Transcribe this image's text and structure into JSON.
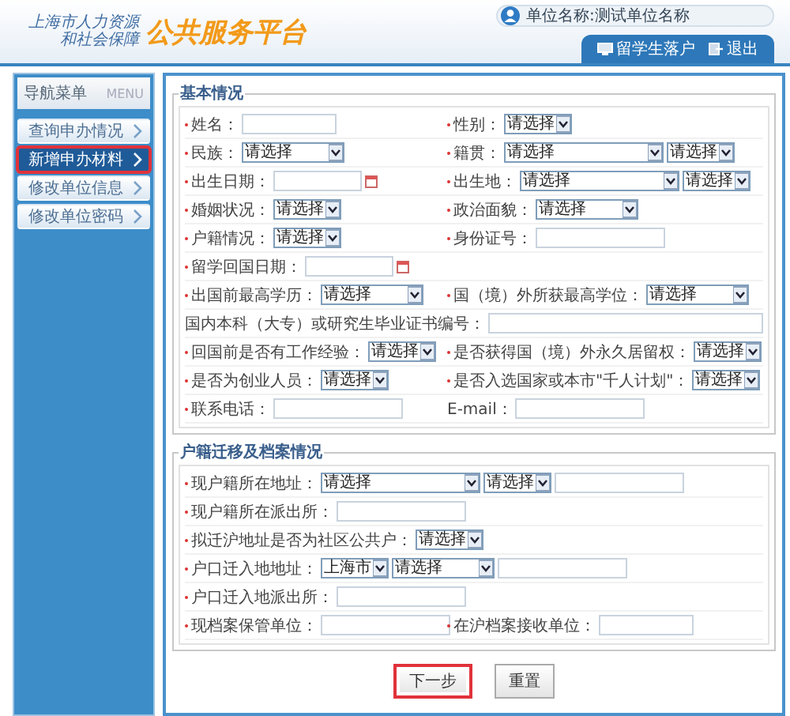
{
  "header": {
    "logo_line1": "上海市人力资源",
    "logo_line2": "和社会保障",
    "platform_title": "公共服务平台",
    "user": "单位名称:测试单位名称",
    "tabs": [
      {
        "label": "留学生落户"
      },
      {
        "label": "退出"
      }
    ]
  },
  "sidebar": {
    "title": "导航菜单",
    "title_en": "MENU",
    "items": [
      {
        "label": "查询申办情况",
        "selected": false,
        "highlighted": false
      },
      {
        "label": "新增申办材料",
        "selected": true,
        "highlighted": true
      },
      {
        "label": "修改单位信息",
        "selected": false,
        "highlighted": false
      },
      {
        "label": "修改单位密码",
        "selected": false,
        "highlighted": false
      }
    ]
  },
  "sections": [
    {
      "title": "基本情况",
      "rows": [
        {
          "cells": [
            {
              "label": "姓名：",
              "bullet": true,
              "controls": [
                {
                  "kind": "shortinput"
                }
              ]
            },
            {
              "label": "性别：",
              "bullet": true,
              "controls": [
                {
                  "kind": "select",
                  "value": "请选择"
                }
              ]
            }
          ]
        },
        {
          "cells": [
            {
              "label": "民族：",
              "bullet": true,
              "controls": [
                {
                  "kind": "wideselect",
                  "value": "请选择"
                }
              ]
            },
            {
              "label": "籍贯：",
              "bullet": true,
              "controls": [
                {
                  "kind": "longselect",
                  "value": "请选择"
                },
                {
                  "kind": "select",
                  "value": "请选择"
                }
              ]
            }
          ]
        },
        {
          "cells": [
            {
              "label": "出生日期：",
              "bullet": true,
              "controls": [
                {
                  "kind": "date"
                }
              ]
            },
            {
              "label": "出生地：",
              "bullet": true,
              "controls": [
                {
                  "kind": "longselect",
                  "value": "请选择"
                },
                {
                  "kind": "select",
                  "value": "请选择"
                }
              ]
            }
          ]
        },
        {
          "cells": [
            {
              "label": "婚姻状况：",
              "bullet": true,
              "controls": [
                {
                  "kind": "select",
                  "value": "请选择"
                }
              ]
            },
            {
              "label": "政治面貌：",
              "bullet": true,
              "controls": [
                {
                  "kind": "wideselect",
                  "value": "请选择"
                }
              ]
            }
          ]
        },
        {
          "cells": [
            {
              "label": "户籍情况：",
              "bullet": true,
              "controls": [
                {
                  "kind": "select",
                  "value": "请选择"
                }
              ]
            },
            {
              "label": "身份证号：",
              "bullet": true,
              "controls": [
                {
                  "kind": "input"
                }
              ]
            }
          ]
        },
        {
          "cells": [
            {
              "label": "留学回国日期：",
              "bullet": true,
              "controls": [
                {
                  "kind": "date"
                }
              ]
            }
          ]
        },
        {
          "cells": [
            {
              "label": "出国前最高学历：",
              "bullet": true,
              "controls": [
                {
                  "kind": "wideselect",
                  "value": "请选择"
                }
              ]
            },
            {
              "label": "国（境）外所获最高学位：",
              "bullet": true,
              "controls": [
                {
                  "kind": "wideselect",
                  "value": "请选择"
                }
              ]
            }
          ]
        },
        {
          "cells": [
            {
              "label": "国内本科（大专）或研究生毕业证书编号：",
              "bullet": false,
              "controls": [
                {
                  "kind": "longinput"
                }
              ]
            }
          ]
        },
        {
          "cells": [
            {
              "label": "回国前是否有工作经验：",
              "bullet": true,
              "controls": [
                {
                  "kind": "select",
                  "value": "请选择"
                }
              ]
            },
            {
              "label": "是否获得国（境）外永久居留权：",
              "bullet": true,
              "controls": [
                {
                  "kind": "select",
                  "value": "请选择"
                }
              ]
            }
          ]
        },
        {
          "cells": [
            {
              "label": "是否为创业人员：",
              "bullet": true,
              "controls": [
                {
                  "kind": "select",
                  "value": "请选择"
                }
              ]
            },
            {
              "label": "是否入选国家或本市\"千人计划\"：",
              "bullet": true,
              "controls": [
                {
                  "kind": "select",
                  "value": "请选择"
                }
              ]
            }
          ]
        },
        {
          "cells": [
            {
              "label": "联系电话：",
              "bullet": true,
              "controls": [
                {
                  "kind": "input"
                }
              ]
            },
            {
              "label": "E-mail：",
              "bullet": false,
              "controls": [
                {
                  "kind": "input"
                }
              ]
            }
          ]
        }
      ]
    },
    {
      "title": "户籍迁移及档案情况",
      "rows": [
        {
          "cells": [
            {
              "label": "现户籍所在地址：",
              "bullet": true,
              "controls": [
                {
                  "kind": "longselect",
                  "value": "请选择"
                },
                {
                  "kind": "select",
                  "value": "请选择"
                },
                {
                  "kind": "input"
                }
              ]
            }
          ]
        },
        {
          "cells": [
            {
              "label": "现户籍所在派出所：",
              "bullet": true,
              "controls": [
                {
                  "kind": "input"
                }
              ]
            }
          ]
        },
        {
          "cells": [
            {
              "label": "拟迁沪地址是否为社区公共户：",
              "bullet": true,
              "controls": [
                {
                  "kind": "select",
                  "value": "请选择"
                }
              ]
            }
          ]
        },
        {
          "cells": [
            {
              "label": "户口迁入地地址：",
              "bullet": true,
              "controls": [
                {
                  "kind": "select",
                  "value": "上海市"
                },
                {
                  "kind": "wideselect",
                  "value": "请选择"
                },
                {
                  "kind": "input"
                }
              ]
            }
          ]
        },
        {
          "cells": [
            {
              "label": "户口迁入地派出所：",
              "bullet": true,
              "controls": [
                {
                  "kind": "input"
                }
              ]
            }
          ]
        },
        {
          "cells": [
            {
              "label": "现档案保管单位：",
              "bullet": true,
              "controls": [
                {
                  "kind": "input"
                }
              ]
            },
            {
              "label": "在沪档案接收单位：",
              "bullet": true,
              "controls": [
                {
                  "kind": "shortinput"
                }
              ]
            }
          ]
        }
      ]
    }
  ],
  "buttons": [
    {
      "label": "下一步",
      "highlighted": true
    },
    {
      "label": "重置",
      "highlighted": false
    }
  ]
}
